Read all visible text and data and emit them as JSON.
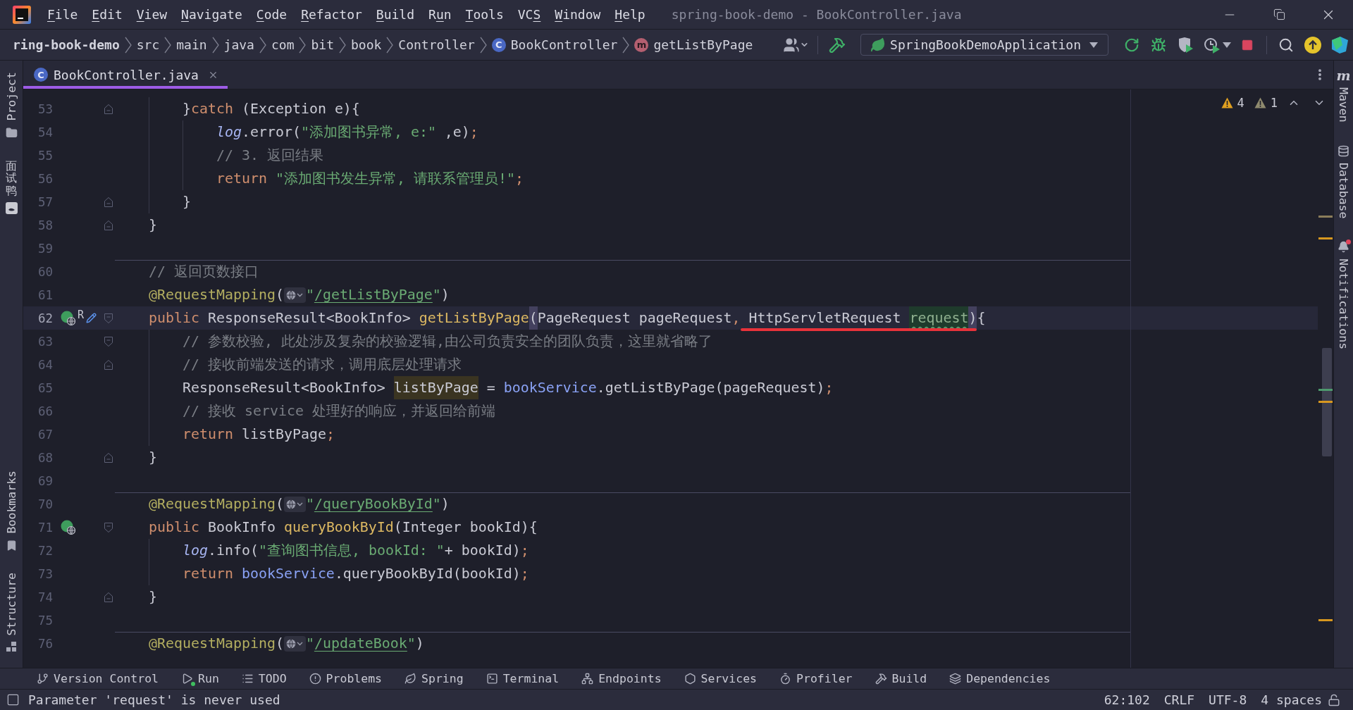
{
  "window": {
    "title": "spring-book-demo - BookController.java"
  },
  "menu": [
    {
      "mnemonic": "F",
      "after": "ile"
    },
    {
      "mnemonic": "E",
      "after": "dit"
    },
    {
      "mnemonic": "V",
      "after": "iew"
    },
    {
      "mnemonic": "N",
      "after": "avigate"
    },
    {
      "mnemonic": "C",
      "after": "ode"
    },
    {
      "mnemonic": "R",
      "after": "efactor"
    },
    {
      "mnemonic": "B",
      "after": "uild"
    },
    {
      "before": "R",
      "mnemonic": "u",
      "after": "n"
    },
    {
      "mnemonic": "T",
      "after": "ools"
    },
    {
      "before": "VC",
      "mnemonic": "S"
    },
    {
      "mnemonic": "W",
      "after": "indow"
    },
    {
      "mnemonic": "H",
      "after": "elp"
    }
  ],
  "breadcrumbs": [
    {
      "label": "ring-book-demo",
      "kind": "project"
    },
    {
      "label": "src",
      "kind": "folder"
    },
    {
      "label": "main",
      "kind": "folder"
    },
    {
      "label": "java",
      "kind": "folder"
    },
    {
      "label": "com",
      "kind": "folder"
    },
    {
      "label": "bit",
      "kind": "folder"
    },
    {
      "label": "book",
      "kind": "folder"
    },
    {
      "label": "Controller",
      "kind": "folder"
    },
    {
      "label": "BookController",
      "kind": "class",
      "icon_letter": "C"
    },
    {
      "label": "getListByPage",
      "kind": "method",
      "icon_letter": "m"
    }
  ],
  "run_configuration": {
    "name": "SpringBookDemoApplication"
  },
  "left_tool_strip": {
    "top": [
      {
        "label": "Project",
        "kind": "project"
      },
      {
        "label": "面试鸭",
        "kind": "plugin"
      }
    ],
    "bottom": [
      {
        "label": "Bookmarks",
        "kind": "bookmarks"
      },
      {
        "label": "Structure",
        "kind": "structure"
      }
    ]
  },
  "editor_tabs": [
    {
      "label": "BookController.java",
      "kind": "class",
      "icon_letter": "C",
      "selected": true
    }
  ],
  "inspections": {
    "warnings": "4",
    "weak_warnings": "1"
  },
  "code_lines": [
    {
      "number": "53",
      "current": false,
      "fold": {
        "kind": "end"
      },
      "code": [
        {
          "kind": "plain",
          "text": "        }"
        },
        {
          "kind": "keyword",
          "text": "catch"
        },
        {
          "kind": "plain",
          "text": " (Exception e){"
        }
      ]
    },
    {
      "number": "54",
      "current": false,
      "code": [
        {
          "kind": "static_field",
          "text": "            log"
        },
        {
          "kind": "plain",
          "text": ".error("
        },
        {
          "kind": "string",
          "text": "\"添加图书异常, e:\""
        },
        {
          "kind": "plain",
          "text": " ,e)"
        },
        {
          "kind": "punct",
          "text": ";"
        }
      ]
    },
    {
      "number": "55",
      "current": false,
      "code": [
        {
          "kind": "comment",
          "text": "            // 3. 返回结果"
        }
      ]
    },
    {
      "number": "56",
      "current": false,
      "code": [
        {
          "kind": "keyword",
          "text": "            return"
        },
        {
          "kind": "string",
          "text": " \"添加图书发生异常, 请联系管理员!\""
        },
        {
          "kind": "punct",
          "text": ";"
        }
      ]
    },
    {
      "number": "57",
      "current": false,
      "fold": {
        "kind": "end"
      },
      "code": [
        {
          "kind": "plain",
          "text": "        }"
        }
      ]
    },
    {
      "number": "58",
      "current": false,
      "fold": {
        "kind": "end"
      },
      "code": [
        {
          "kind": "plain",
          "text": "    }"
        }
      ]
    },
    {
      "number": "59",
      "current": false
    },
    {
      "number": "60",
      "current": false,
      "code": [
        {
          "kind": "comment",
          "text": "    // 返回页数接口"
        }
      ]
    },
    {
      "number": "61",
      "current": false,
      "code": [
        {
          "kind": "annotation",
          "text": "    @RequestMapping"
        },
        {
          "kind": "plain",
          "text": "("
        },
        {
          "kind": "inlay"
        },
        {
          "kind": "string",
          "text": "\""
        },
        {
          "kind": "link",
          "text": "/getListByPage"
        },
        {
          "kind": "string",
          "text": "\""
        },
        {
          "kind": "plain",
          "text": ")"
        }
      ]
    },
    {
      "number": "62",
      "current": true,
      "fold": {
        "kind": "start"
      },
      "gutter_icons": [
        {
          "kind": "endpoint"
        },
        {
          "kind": "rename",
          "letter": "R"
        }
      ],
      "code": [
        {
          "kind": "keyword",
          "text": "    public"
        },
        {
          "kind": "plain",
          "text": " ResponseResult<BookInfo> "
        },
        {
          "kind": "method",
          "text": "getListByPage"
        },
        {
          "kind": "brace_match",
          "text": "("
        },
        {
          "kind": "plain",
          "text": "PageRequest pageRequest"
        },
        {
          "kind": "punct",
          "text": ","
        },
        {
          "kind": "underlined",
          "code": [
            {
              "kind": "plain",
              "text": " HttpServletRequest "
            },
            {
              "kind": "unused",
              "text": "request"
            },
            {
              "kind": "brace_match",
              "text": ")"
            }
          ]
        },
        {
          "kind": "plain",
          "text": "{"
        }
      ]
    },
    {
      "number": "63",
      "current": false,
      "fold": {
        "kind": "start"
      },
      "code": [
        {
          "kind": "comment",
          "text": "        // 参数校验, 此处涉及复杂的校验逻辑,由公司负责安全的团队负责，这里就省略了"
        }
      ]
    },
    {
      "number": "64",
      "current": false,
      "fold": {
        "kind": "end"
      },
      "code": [
        {
          "kind": "comment",
          "text": "        // 接收前端发送的请求，调用底层处理请求"
        }
      ]
    },
    {
      "number": "65",
      "current": false,
      "code": [
        {
          "kind": "plain",
          "text": "        ResponseResult<BookInfo> "
        },
        {
          "kind": "usage",
          "text": "listByPage"
        },
        {
          "kind": "plain",
          "text": " = "
        },
        {
          "kind": "field",
          "text": "bookService"
        },
        {
          "kind": "plain",
          "text": ".getListByPage(pageRequest)"
        },
        {
          "kind": "punct",
          "text": ";"
        }
      ]
    },
    {
      "number": "66",
      "current": false,
      "code": [
        {
          "kind": "comment",
          "text": "        // 接收 service 处理好的响应，并返回给前端"
        }
      ]
    },
    {
      "number": "67",
      "current": false,
      "code": [
        {
          "kind": "keyword",
          "text": "        return"
        },
        {
          "kind": "plain",
          "text": " listByPage"
        },
        {
          "kind": "punct",
          "text": ";"
        }
      ]
    },
    {
      "number": "68",
      "current": false,
      "fold": {
        "kind": "end"
      },
      "code": [
        {
          "kind": "plain",
          "text": "    }"
        }
      ]
    },
    {
      "number": "69",
      "current": false
    },
    {
      "number": "70",
      "current": false,
      "code": [
        {
          "kind": "annotation",
          "text": "    @RequestMapping"
        },
        {
          "kind": "plain",
          "text": "("
        },
        {
          "kind": "inlay"
        },
        {
          "kind": "string",
          "text": "\""
        },
        {
          "kind": "link",
          "text": "/queryBookById"
        },
        {
          "kind": "string",
          "text": "\""
        },
        {
          "kind": "plain",
          "text": ")"
        }
      ]
    },
    {
      "number": "71",
      "current": false,
      "fold": {
        "kind": "start"
      },
      "gutter_icons": [
        {
          "kind": "endpoint"
        }
      ],
      "code": [
        {
          "kind": "keyword",
          "text": "    public"
        },
        {
          "kind": "plain",
          "text": " BookInfo "
        },
        {
          "kind": "method",
          "text": "queryBookById"
        },
        {
          "kind": "plain",
          "text": "(Integer bookId){"
        }
      ]
    },
    {
      "number": "72",
      "current": false,
      "code": [
        {
          "kind": "static_field",
          "text": "        log"
        },
        {
          "kind": "plain",
          "text": ".info("
        },
        {
          "kind": "string",
          "text": "\"查询图书信息, bookId: \""
        },
        {
          "kind": "plain",
          "text": "+ bookId)"
        },
        {
          "kind": "punct",
          "text": ";"
        }
      ]
    },
    {
      "number": "73",
      "current": false,
      "code": [
        {
          "kind": "keyword",
          "text": "        return"
        },
        {
          "kind": "field",
          "text": " bookService"
        },
        {
          "kind": "plain",
          "text": ".queryBookById(bookId)"
        },
        {
          "kind": "punct",
          "text": ";"
        }
      ]
    },
    {
      "number": "74",
      "current": false,
      "fold": {
        "kind": "end"
      },
      "code": [
        {
          "kind": "plain",
          "text": "    }"
        }
      ]
    },
    {
      "number": "75",
      "current": false
    },
    {
      "number": "76",
      "current": false,
      "code": [
        {
          "kind": "annotation",
          "text": "    @RequestMapping"
        },
        {
          "kind": "plain",
          "text": "("
        },
        {
          "kind": "inlay"
        },
        {
          "kind": "string",
          "text": "\""
        },
        {
          "kind": "link",
          "text": "/updateBook"
        },
        {
          "kind": "string",
          "text": "\""
        },
        {
          "kind": "plain",
          "text": ")"
        }
      ]
    }
  ],
  "right_tool_strip": [
    {
      "label": "Maven",
      "kind": "maven",
      "icon_letter": "m",
      "badge": false
    },
    {
      "label": "Database",
      "kind": "database",
      "badge": false
    },
    {
      "label": "Notifications",
      "kind": "notifications",
      "badge": true
    }
  ],
  "tool_windows": [
    {
      "label": "Version Control",
      "kind": "vcs",
      "running": false
    },
    {
      "label": "Run",
      "kind": "run",
      "running": true
    },
    {
      "label": "TODO",
      "kind": "todo",
      "running": false
    },
    {
      "label": "Problems",
      "kind": "problems",
      "running": false
    },
    {
      "label": "Spring",
      "kind": "spring",
      "running": false
    },
    {
      "label": "Terminal",
      "kind": "terminal",
      "running": false
    },
    {
      "label": "Endpoints",
      "kind": "endpoints",
      "running": false
    },
    {
      "label": "Services",
      "kind": "services",
      "running": false
    },
    {
      "label": "Profiler",
      "kind": "profiler",
      "running": false
    },
    {
      "label": "Build",
      "kind": "build",
      "running": false
    },
    {
      "label": "Dependencies",
      "kind": "dependencies",
      "running": false
    }
  ],
  "status_bar": {
    "message": "Parameter 'request' is never used",
    "caret_position": "62:102",
    "line_separator": "CRLF",
    "encoding": "UTF-8",
    "indentation": "4 spaces"
  }
}
